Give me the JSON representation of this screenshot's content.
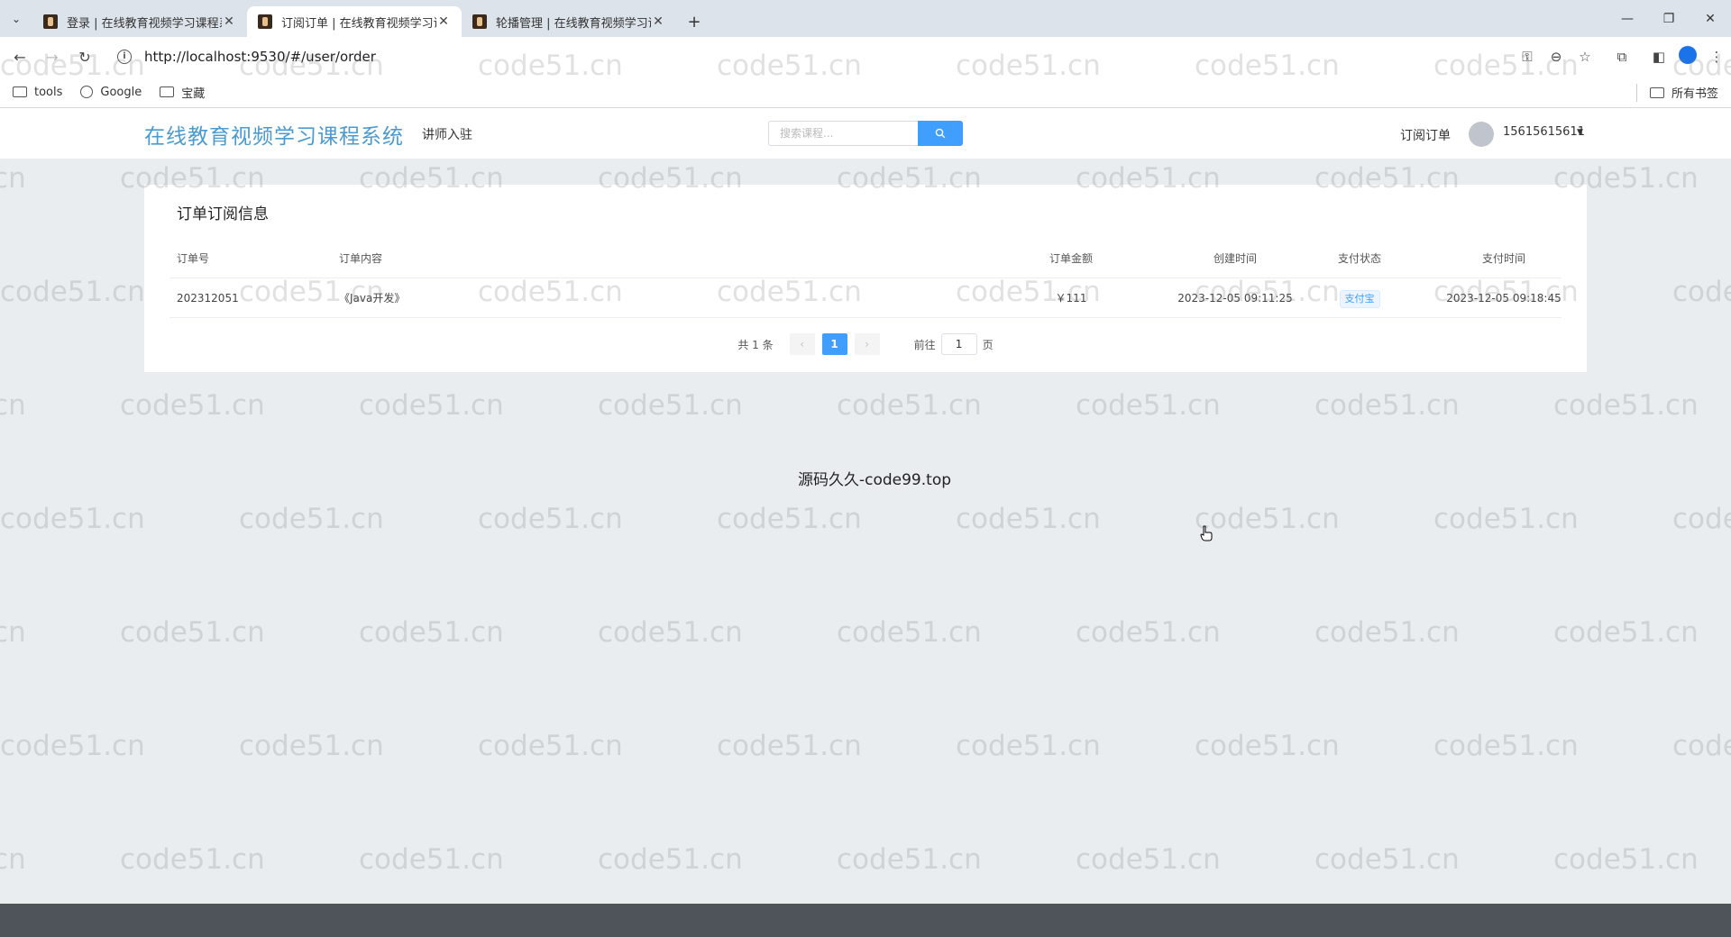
{
  "browser": {
    "tabs": [
      {
        "title": "登录 | 在线教育视频学习课程系",
        "active": false
      },
      {
        "title": "订阅订单 | 在线教育视频学习课",
        "active": true
      },
      {
        "title": "轮播管理 | 在线教育视频学习课",
        "active": false
      }
    ],
    "url": "http://localhost:9530/#/user/order",
    "bookmarks": [
      "tools",
      "Google",
      "宝藏"
    ],
    "all_bookmarks": "所有书签"
  },
  "header": {
    "logo": "在线教育视频学习课程系统",
    "teacher_link": "讲师入驻",
    "search_placeholder": "搜索课程...",
    "orders_link": "订阅订单",
    "username": "15615615611"
  },
  "orders": {
    "title": "订单订阅信息",
    "columns": {
      "no": "订单号",
      "content": "订单内容",
      "amount": "订单金额",
      "created": "创建时间",
      "status": "支付状态",
      "paid": "支付时间"
    },
    "rows": [
      {
        "no": "202312051",
        "content": "《Java开发》",
        "amount": "￥111",
        "created": "2023-12-05 09:11:25",
        "status": "支付宝",
        "paid": "2023-12-05 09:18:45"
      }
    ]
  },
  "pagination": {
    "total": "共 1 条",
    "current": "1",
    "goto_prefix": "前往",
    "goto_value": "1",
    "goto_suffix": "页"
  },
  "footer": {
    "text": "源码久久-code99.top"
  },
  "watermark": "code51.cn",
  "colors": {
    "accent": "#409eff",
    "logo": "#4a9bd1",
    "page_bg": "#e9edf0",
    "bottom_bar": "#4f545b"
  }
}
